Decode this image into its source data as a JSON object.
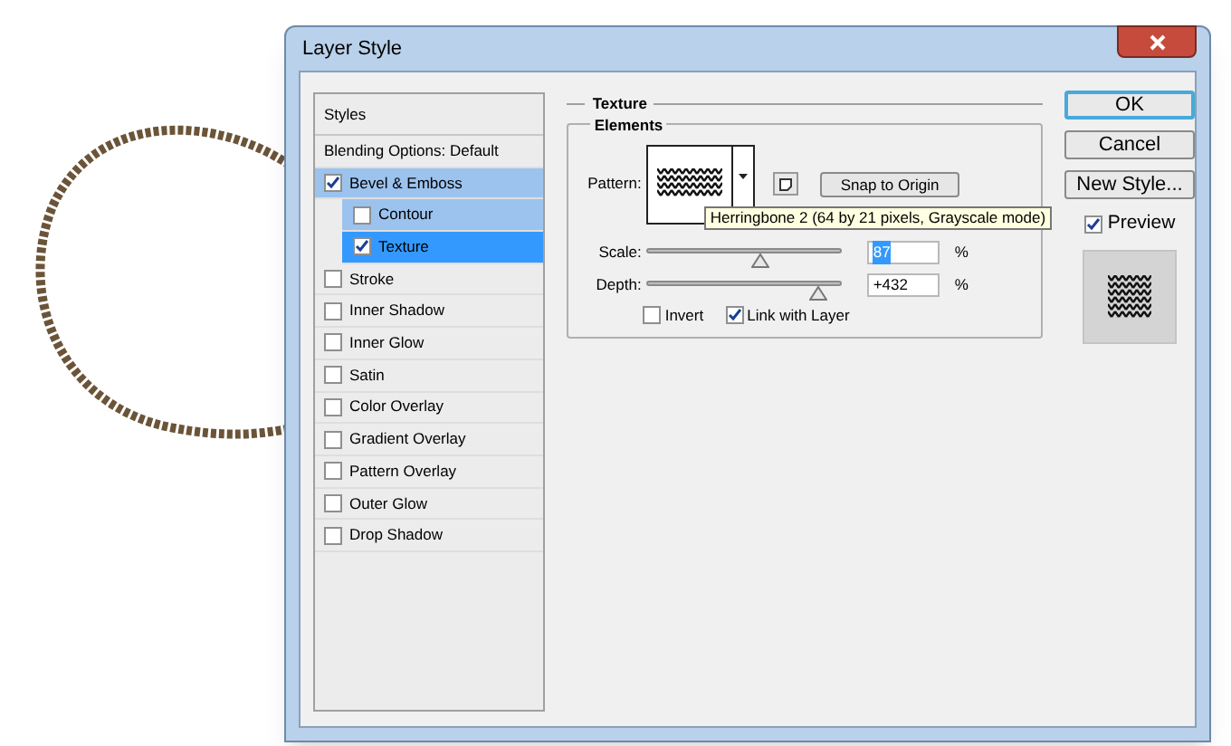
{
  "window": {
    "title": "Layer Style"
  },
  "styles": {
    "header": "Styles",
    "items": [
      {
        "kind": "header",
        "label": "Blending Options: Default",
        "selected": false
      },
      {
        "kind": "check",
        "label": "Bevel & Emboss",
        "checked": true,
        "selected": false,
        "children": [
          {
            "kind": "check",
            "label": "Contour",
            "checked": false,
            "selected": false
          },
          {
            "kind": "check",
            "label": "Texture",
            "checked": true,
            "selected": true
          }
        ]
      },
      {
        "kind": "check",
        "label": "Stroke",
        "checked": false,
        "selected": false
      },
      {
        "kind": "check",
        "label": "Inner Shadow",
        "checked": false,
        "selected": false
      },
      {
        "kind": "check",
        "label": "Inner Glow",
        "checked": false,
        "selected": false
      },
      {
        "kind": "check",
        "label": "Satin",
        "checked": false,
        "selected": false
      },
      {
        "kind": "check",
        "label": "Color Overlay",
        "checked": false,
        "selected": false
      },
      {
        "kind": "check",
        "label": "Gradient Overlay",
        "checked": false,
        "selected": false
      },
      {
        "kind": "check",
        "label": "Pattern Overlay",
        "checked": false,
        "selected": false
      },
      {
        "kind": "check",
        "label": "Outer Glow",
        "checked": false,
        "selected": false
      },
      {
        "kind": "check",
        "label": "Drop Shadow",
        "checked": false,
        "selected": false
      }
    ]
  },
  "texture": {
    "title": "Texture",
    "group": "Elements",
    "pattern_label": "Pattern:",
    "snap_button": "Snap to Origin",
    "tooltip": "Herringbone 2 (64 by 21 pixels, Grayscale mode)",
    "sliders": [
      {
        "label": "Scale:",
        "level": 0.58,
        "value": "87",
        "unit": "%",
        "value_selected": true
      },
      {
        "label": "Depth:",
        "level": 0.88,
        "value": "+432",
        "unit": "%",
        "value_selected": false
      }
    ],
    "options": [
      {
        "label": "Invert",
        "checked": false
      },
      {
        "label": "Link with Layer",
        "checked": true
      }
    ]
  },
  "buttons": [
    {
      "label": "OK",
      "default": true
    },
    {
      "label": "Cancel",
      "default": false
    },
    {
      "label": "New Style...",
      "default": false
    }
  ],
  "preview": {
    "label": "Preview",
    "checked": true
  }
}
